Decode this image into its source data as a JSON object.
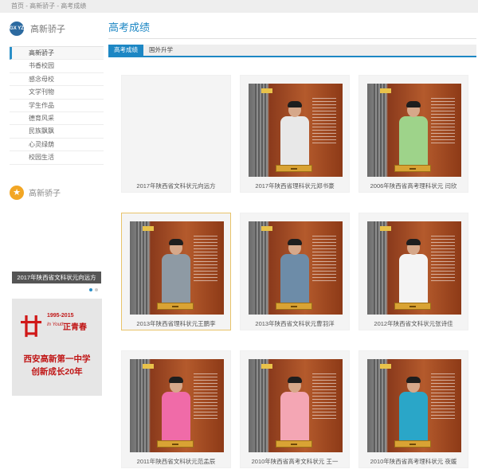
{
  "breadcrumb": "首页 - 高新骄子 - 高考成绩",
  "sidebar": {
    "logo_badge": "GX YZ",
    "logo_text": "高新骄子",
    "items": [
      {
        "label": "高新骄子",
        "active": true
      },
      {
        "label": "书香校园",
        "active": false
      },
      {
        "label": "感念母校",
        "active": false
      },
      {
        "label": "文学刊物",
        "active": false
      },
      {
        "label": "学生作品",
        "active": false
      },
      {
        "label": "德育风采",
        "active": false
      },
      {
        "label": "民族飘飘",
        "active": false
      },
      {
        "label": "心灵绿荫",
        "active": false
      },
      {
        "label": "校园生活",
        "active": false
      }
    ],
    "star_text": "高新骄子",
    "slide_caption": "2017年陕西省文科状元向远方",
    "banner": {
      "mark": "廿",
      "years": "1995-2015",
      "youth": "In Youth",
      "slogan": "正青春",
      "line1": "西安高新第一中学",
      "line2": "创新成长20年"
    }
  },
  "main": {
    "title": "高考成绩",
    "tabs": [
      {
        "label": "高考成绩",
        "active": true
      },
      {
        "label": "国外升学",
        "active": false
      }
    ],
    "cards": [
      {
        "caption": "2017年陕西省文科状元向远方",
        "photo": false,
        "shirt": "#ffffff"
      },
      {
        "caption": "2017年陕西省理科状元郑书豪",
        "photo": true,
        "shirt": "#e8e8e8"
      },
      {
        "caption": "2006年陕西省高考理科状元 闫欣",
        "photo": true,
        "shirt": "#9ed38a"
      },
      {
        "caption": "2013年陕西省理科状元王鹏李",
        "photo": true,
        "shirt": "#8e9aa4",
        "selected": true
      },
      {
        "caption": "2013年陕西省文科状元曹羽洋",
        "photo": true,
        "shirt": "#6d8ca8"
      },
      {
        "caption": "2012年陕西省文科状元张诗佳",
        "photo": true,
        "shirt": "#f4f4f4"
      },
      {
        "caption": "2011年陕西省文科状元范孟辰",
        "photo": true,
        "shirt": "#f06ba8"
      },
      {
        "caption": "2010年陕西省高考文科状元 王一",
        "photo": true,
        "shirt": "#f4a6b4"
      },
      {
        "caption": "2010年陕西省高考理科状元 夜媛",
        "photo": true,
        "shirt": "#2aa6c8"
      }
    ]
  }
}
